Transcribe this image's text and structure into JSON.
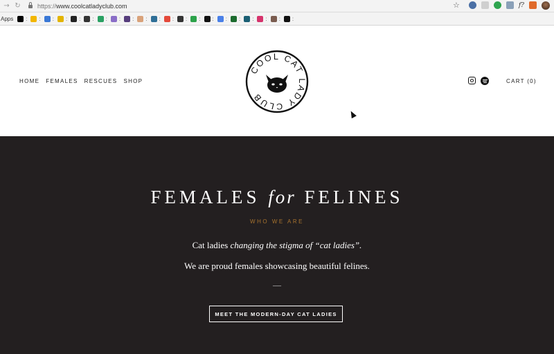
{
  "browser": {
    "url_protocol": "https://",
    "url_host": "www.coolcatladyclub.com",
    "bookmarks_apps_label": "Apps",
    "bookmark_separator": ":",
    "extension_text_icon": "f?",
    "bookmark_icons": [
      {
        "name": "amazon-icon",
        "color": "#000000",
        "glyph": "a"
      },
      {
        "name": "yellow-bookmark-icon",
        "color": "#f2b600",
        "glyph": ""
      },
      {
        "name": "calendar-icon",
        "color": "#3a78d6",
        "glyph": ""
      },
      {
        "name": "imdb-icon",
        "color": "#e3b400",
        "glyph": ""
      },
      {
        "name": "dark-square-icon",
        "color": "#222222",
        "glyph": ""
      },
      {
        "name": "target-icon",
        "color": "#333333",
        "glyph": ""
      },
      {
        "name": "green-bookmark-icon",
        "color": "#2aa163",
        "glyph": ""
      },
      {
        "name": "purple-k-icon",
        "color": "#8a6dc7",
        "glyph": ""
      },
      {
        "name": "bootstrap-icon",
        "color": "#563d7c",
        "glyph": "B"
      },
      {
        "name": "drop-icon",
        "color": "#d9a27a",
        "glyph": ""
      },
      {
        "name": "blue-square-icon",
        "color": "#2f6f97",
        "glyph": ""
      },
      {
        "name": "figma-icon",
        "color": "#e4493a",
        "glyph": ""
      },
      {
        "name": "tag-icon",
        "color": "#333333",
        "glyph": ""
      },
      {
        "name": "green-h-icon",
        "color": "#2ca24a",
        "glyph": ""
      },
      {
        "name": "medium-icon",
        "color": "#111111",
        "glyph": "M"
      },
      {
        "name": "docs-icon",
        "color": "#4a80e8",
        "glyph": ""
      },
      {
        "name": "green-square-icon",
        "color": "#1c6b2e",
        "glyph": ""
      },
      {
        "name": "cube-icon",
        "color": "#1b5f74",
        "glyph": ""
      },
      {
        "name": "pink-circle-icon",
        "color": "#d6336c",
        "glyph": ""
      },
      {
        "name": "brown-circle-icon",
        "color": "#7a5c4f",
        "glyph": ""
      },
      {
        "name": "github-icon",
        "color": "#111111",
        "glyph": ""
      }
    ]
  },
  "site": {
    "nav": [
      "HOME",
      "FEMALES",
      "RESCUES",
      "SHOP"
    ],
    "logo_text": "COOL CAT LADY CLUB",
    "cart_label": "CART (0)",
    "social_icons": [
      "instagram-icon",
      "spotify-icon"
    ]
  },
  "hero": {
    "title_part1": "FEMALES",
    "title_italic": "for",
    "title_part2": "FELINES",
    "kicker": "WHO WE ARE",
    "line1_plain": "Cat ladies ",
    "line1_italic": "changing the stigma of “cat ladies”.",
    "line2": "We are proud females showcasing beautiful felines.",
    "divider": "—",
    "cta_label": "MEET THE MODERN-DAY CAT LADIES",
    "accent_color": "#a8732e",
    "background_color": "#231f20"
  }
}
